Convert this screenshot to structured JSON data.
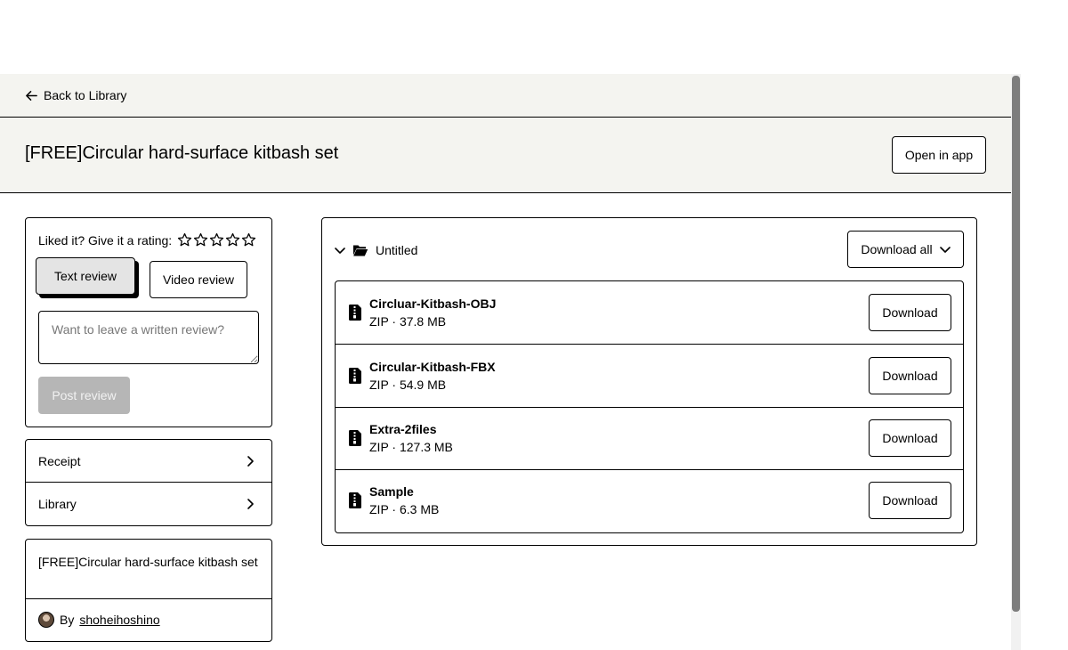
{
  "topbar": {
    "back_label": "Back to Library"
  },
  "header": {
    "title": "[FREE]Circular hard-surface kitbash set",
    "open_app_label": "Open in app"
  },
  "rating": {
    "prompt": "Liked it? Give it a rating:",
    "stars_total": 5,
    "tabs": [
      {
        "label": "Text review",
        "active": true
      },
      {
        "label": "Video review",
        "active": false
      }
    ],
    "review_placeholder": "Want to leave a written review?",
    "post_label": "Post review"
  },
  "links": [
    {
      "label": "Receipt"
    },
    {
      "label": "Library"
    }
  ],
  "product": {
    "name": "[FREE]Circular hard-surface kitbash set",
    "by_label": "By",
    "creator": "shoheihoshino"
  },
  "files": {
    "folder_name": "Untitled",
    "download_all_label": "Download all",
    "download_label": "Download",
    "items": [
      {
        "name": "Circluar-Kitbash-OBJ",
        "meta": "ZIP · 37.8 MB"
      },
      {
        "name": "Circular-Kitbash-FBX",
        "meta": "ZIP · 54.9 MB"
      },
      {
        "name": "Extra-2files",
        "meta": "ZIP · 127.3 MB"
      },
      {
        "name": "Sample",
        "meta": "ZIP · 6.3 MB"
      }
    ]
  },
  "icons": {
    "back": "arrow-left-icon",
    "star": "star-outline-icon",
    "chevron_right": "chevron-right-icon",
    "chevron_down": "chevron-down-icon",
    "folder": "folder-open-icon",
    "file": "zip-file-icon"
  },
  "colors": {
    "header_bg": "#f4f4f0",
    "post_button_bg": "#b6b6b6",
    "active_tab_bg": "#e4e4e4"
  }
}
